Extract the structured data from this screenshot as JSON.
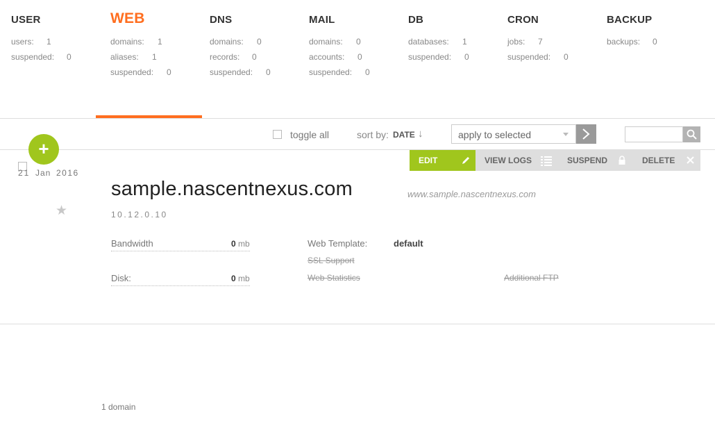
{
  "menu": [
    {
      "id": "user",
      "title": "USER",
      "rows": [
        {
          "k": "users:",
          "v": "1"
        },
        {
          "k": "suspended:",
          "v": "0"
        }
      ]
    },
    {
      "id": "web",
      "title": "WEB",
      "rows": [
        {
          "k": "domains:",
          "v": "1"
        },
        {
          "k": "aliases:",
          "v": "1"
        },
        {
          "k": "suspended:",
          "v": "0"
        }
      ]
    },
    {
      "id": "dns",
      "title": "DNS",
      "rows": [
        {
          "k": "domains:",
          "v": "0"
        },
        {
          "k": "records:",
          "v": "0"
        },
        {
          "k": "suspended:",
          "v": "0"
        }
      ]
    },
    {
      "id": "mail",
      "title": "MAIL",
      "rows": [
        {
          "k": "domains:",
          "v": "0"
        },
        {
          "k": "accounts:",
          "v": "0"
        },
        {
          "k": "suspended:",
          "v": "0"
        }
      ]
    },
    {
      "id": "db",
      "title": "DB",
      "rows": [
        {
          "k": "databases:",
          "v": "1"
        },
        {
          "k": "suspended:",
          "v": "0"
        }
      ]
    },
    {
      "id": "cron",
      "title": "CRON",
      "rows": [
        {
          "k": "jobs:",
          "v": "7"
        },
        {
          "k": "suspended:",
          "v": "0"
        }
      ]
    },
    {
      "id": "backup",
      "title": "BACKUP",
      "rows": [
        {
          "k": "backups:",
          "v": "0"
        }
      ]
    }
  ],
  "active_menu": "web",
  "toolbar": {
    "toggle_all": "toggle all",
    "sort_by": "sort by:",
    "sort_value": "DATE",
    "sort_arrow": "↓",
    "apply_placeholder": "apply to selected",
    "search_value": ""
  },
  "add_button": "+",
  "actions": {
    "edit": "EDIT",
    "view_logs": "VIEW LOGS",
    "suspend": "SUSPEND",
    "delete": "DELETE"
  },
  "domain": {
    "day": "21",
    "month": "Jan",
    "year": "2016",
    "star": "★",
    "name": "sample.nascentnexus.com",
    "alias": "www.sample.nascentnexus.com",
    "ip": "10.12.0.10",
    "bandwidth_label": "Bandwidth",
    "bandwidth_value": "0",
    "bandwidth_unit": "mb",
    "disk_label": "Disk:",
    "disk_value": "0",
    "disk_unit": "mb",
    "web_template_label": "Web Template:",
    "web_template_value": "default",
    "ssl_support": "SSL Support",
    "web_statistics": "Web Statistics",
    "additional_ftp": "Additional FTP"
  },
  "footer": {
    "count": "1 domain"
  },
  "colors": {
    "accent": "#ff6e1f",
    "green": "#a0c61d"
  }
}
